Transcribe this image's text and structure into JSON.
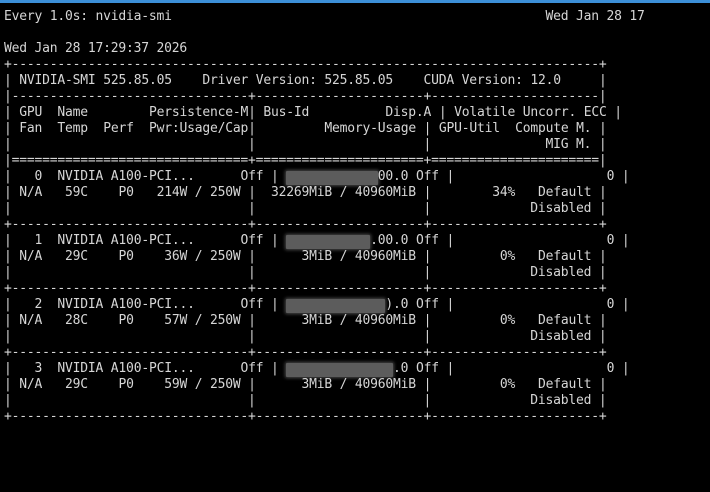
{
  "header": {
    "watch_command": "Every 1.0s: nvidia-smi",
    "clock_right": "Wed Jan 28 17",
    "timestamp": "Wed Jan 28 17:29:37 2026"
  },
  "smi": {
    "version_label": "NVIDIA-SMI",
    "version": "525.85.05",
    "driver_label": "Driver Version:",
    "driver_version": "525.85.05",
    "cuda_label": "CUDA Version:",
    "cuda_version": "12.0"
  },
  "columns": {
    "row1": [
      "GPU",
      "Name",
      "Persistence-M",
      "Bus-Id",
      "Disp.A",
      "Volatile Uncorr. ECC"
    ],
    "row2": [
      "Fan",
      "Temp",
      "Perf",
      "Pwr:Usage/Cap",
      "Memory-Usage",
      "GPU-Util",
      "Compute M."
    ],
    "row3": [
      "MIG M."
    ]
  },
  "gpus": [
    {
      "index": "0",
      "name": "NVIDIA A100-PCI...",
      "persistence": "Off",
      "bus_id_visible": "00.0",
      "disp": "Off",
      "ecc": "0",
      "fan": "N/A",
      "temp": "59C",
      "perf": "P0",
      "power": "214W / 250W",
      "memory": "32269MiB / 40960MiB",
      "util": "34%",
      "compute_mode": "Default",
      "mig_mode": "Disabled"
    },
    {
      "index": "1",
      "name": "NVIDIA A100-PCI...",
      "persistence": "Off",
      "bus_id_visible": ".00.0",
      "disp": "Off",
      "ecc": "0",
      "fan": "N/A",
      "temp": "29C",
      "perf": "P0",
      "power": "36W / 250W",
      "memory": "3MiB / 40960MiB",
      "util": "0%",
      "compute_mode": "Default",
      "mig_mode": "Disabled"
    },
    {
      "index": "2",
      "name": "NVIDIA A100-PCI...",
      "persistence": "Off",
      "bus_id_visible": ").0",
      "disp": "Off",
      "ecc": "0",
      "fan": "N/A",
      "temp": "28C",
      "perf": "P0",
      "power": "57W / 250W",
      "memory": "3MiB / 40960MiB",
      "util": "0%",
      "compute_mode": "Default",
      "mig_mode": "Disabled"
    },
    {
      "index": "3",
      "name": "NVIDIA A100-PCI...",
      "persistence": "Off",
      "bus_id_visible": ".0",
      "disp": "Off",
      "ecc": "0",
      "fan": "N/A",
      "temp": "29C",
      "perf": "P0",
      "power": "59W / 250W",
      "memory": "3MiB / 40960MiB",
      "util": "0%",
      "compute_mode": "Default",
      "mig_mode": "Disabled"
    }
  ],
  "colors": {
    "background": "#000000",
    "text": "#d6d6d6",
    "title_bar_accent": "#3c8fd8",
    "redaction": "#5c5c5c"
  }
}
